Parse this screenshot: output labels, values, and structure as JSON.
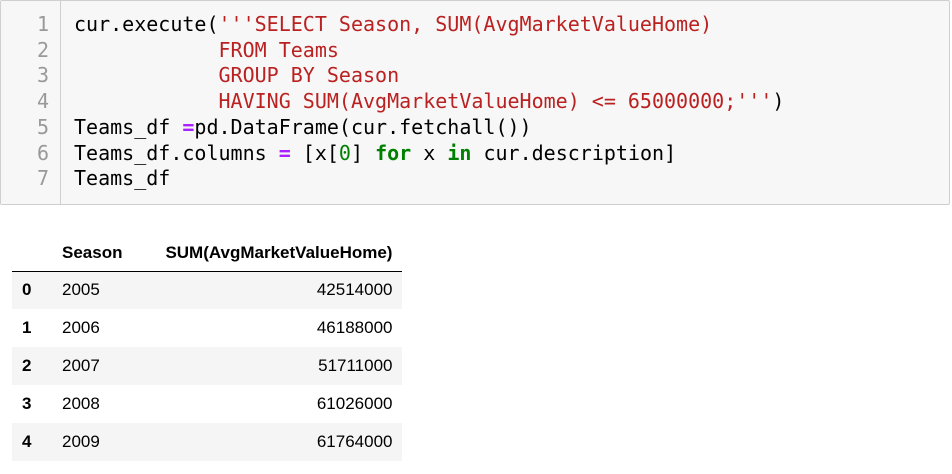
{
  "code_cell": {
    "lines": [
      {
        "number": "1",
        "parts": [
          {
            "text": "cur.execute(",
            "kind": "plain"
          },
          {
            "text": "'''SELECT Season, SUM(AvgMarketValueHome)",
            "kind": "str"
          }
        ]
      },
      {
        "number": "2",
        "parts": [
          {
            "text": "            ",
            "kind": "plain"
          },
          {
            "text": "FROM Teams",
            "kind": "str"
          }
        ]
      },
      {
        "number": "3",
        "parts": [
          {
            "text": "            ",
            "kind": "plain"
          },
          {
            "text": "GROUP BY Season",
            "kind": "str"
          }
        ]
      },
      {
        "number": "4",
        "parts": [
          {
            "text": "            ",
            "kind": "plain"
          },
          {
            "text": "HAVING SUM(AvgMarketValueHome) <= 65000000;'''",
            "kind": "str"
          },
          {
            "text": ")",
            "kind": "plain"
          }
        ]
      },
      {
        "number": "5",
        "parts": [
          {
            "text": "Teams_df ",
            "kind": "plain"
          },
          {
            "text": "=",
            "kind": "op"
          },
          {
            "text": "pd.DataFrame(cur.fetchall())",
            "kind": "plain"
          }
        ]
      },
      {
        "number": "6",
        "parts": [
          {
            "text": "Teams_df.columns ",
            "kind": "plain"
          },
          {
            "text": "=",
            "kind": "op"
          },
          {
            "text": " [x[",
            "kind": "plain"
          },
          {
            "text": "0",
            "kind": "num"
          },
          {
            "text": "] ",
            "kind": "plain"
          },
          {
            "text": "for",
            "kind": "kw"
          },
          {
            "text": " x ",
            "kind": "plain"
          },
          {
            "text": "in",
            "kind": "kw"
          },
          {
            "text": " cur.description]",
            "kind": "plain"
          }
        ]
      },
      {
        "number": "7",
        "parts": [
          {
            "text": "Teams_df",
            "kind": "plain"
          }
        ]
      }
    ]
  },
  "output_table": {
    "columns": [
      "",
      "Season",
      "SUM(AvgMarketValueHome)"
    ],
    "rows": [
      {
        "index": "0",
        "season": "2005",
        "value": "42514000"
      },
      {
        "index": "1",
        "season": "2006",
        "value": "46188000"
      },
      {
        "index": "2",
        "season": "2007",
        "value": "51711000"
      },
      {
        "index": "3",
        "season": "2008",
        "value": "61026000"
      },
      {
        "index": "4",
        "season": "2009",
        "value": "61764000"
      }
    ]
  },
  "colors": {
    "string": "#ba2121",
    "keyword": "#008000",
    "operator": "#aa22ff",
    "number": "#008000",
    "line_number": "#999999",
    "cell_background": "#f7f7f7"
  }
}
